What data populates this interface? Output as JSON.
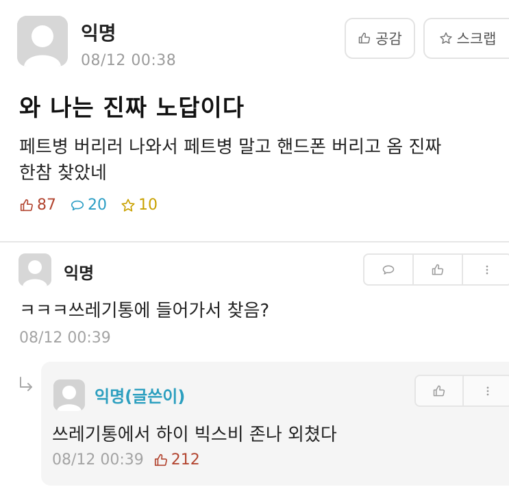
{
  "post": {
    "author": "익명",
    "time": "08/12 00:38",
    "like_button": "공감",
    "scrap_button": "스크랩",
    "title": "와 나는 진짜 노답이다",
    "body_line1": "페트병 버리러 나와서 페트병 말고 핸드폰 버리고 옴 진짜",
    "body_line2": "한참 찾았네",
    "likes": "87",
    "comments": "20",
    "scraps": "10"
  },
  "comment": {
    "author": "익명",
    "text": "ㅋㅋㅋ쓰레기통에 들어가서 찾음?",
    "time": "08/12 00:39"
  },
  "reply": {
    "author": "익명(글쓴이)",
    "text": "쓰레기통에서 하이 빅스비 존나 외쳤다",
    "time": "08/12 00:39",
    "likes": "212"
  },
  "colors": {
    "like": "#b2442f",
    "comment": "#2a9dc4",
    "scrap": "#c9a100",
    "op_author": "#2c9fbf"
  }
}
